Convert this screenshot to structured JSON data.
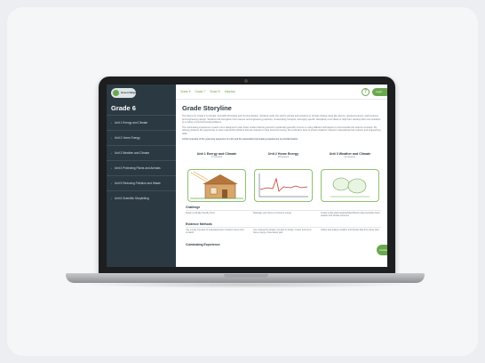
{
  "sidebar": {
    "logo_text": "Green Ninja",
    "grade_title": "Grade 6",
    "units": [
      {
        "label": "Unit 1 Energy and Climate"
      },
      {
        "label": "Unit 2 Home Energy"
      },
      {
        "label": "Unit 3 Weather and Climate"
      },
      {
        "label": "Unit 4 Protecting Plants and Animals"
      },
      {
        "label": "Unit 5 Reducing Pollution and Waste"
      },
      {
        "label": "Unit 6 Scientific Storytelling"
      }
    ]
  },
  "topbar": {
    "tabs": [
      "Grade 6",
      "Grade 7",
      "Grade 8",
      "Adoption"
    ],
    "help_icon": "?",
    "login_label": "Login"
  },
  "main": {
    "title": "Grade Storyline",
    "para1": "The theme for Grade 6 is Climate: Scientific Principles and Communication. Students study the earth's climate and solutions to climate change using life science, physical science, earth science, and engineering design. Students will strengthen their science and engineering practices, crosscutting concepts, and apply specific disciplinary core ideas to help them develop their own solutions to a variety of environmental problems.",
    "para2": "The culminating experience in each unit is designed to help foster student learning around a particular goal with a focus on using different techniques to communicate the science concepts. By offering students the opportunity to solve real-world problems that are relevant to their local community, the curriculum aims to inspire students' interest in developing their science and engineering skills.",
    "para3": "A brief overview of the year-long sequence of units and the associated culminating experiences is provided below.",
    "unit_columns": [
      {
        "title": "Unit 1 Energy and Climate",
        "sub": "27 lessons"
      },
      {
        "title": "Unit 2 Home Energy",
        "sub": "28 lessons"
      },
      {
        "title": "Unit 3 Weather and Climate",
        "sub": "21 lessons"
      }
    ],
    "challenge_heading": "Challenge",
    "challenge": [
      "Design a climate-friendly home",
      "Redesign your home to conserve energy",
      "Create a drip-watering/dehydrated/device about possible future weather and climate extremes"
    ],
    "evidence_heading": "Evidence Methods",
    "evidence": [
      "Use energy concepts to evaluate/present models to keep cool on Earth",
      "Use engineering design concepts to design, model, and test a home energy conservation plan",
      "Collect and analyze weather and climate data from these sites"
    ],
    "culminating_heading": "Culminating Experience",
    "contact_label": "Contact"
  }
}
